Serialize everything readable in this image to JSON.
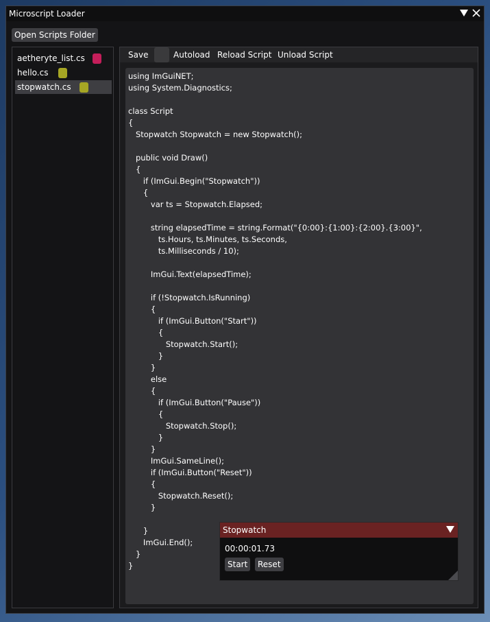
{
  "window": {
    "title": "Microscript Loader"
  },
  "toolbar": {
    "open_folder_label": "Open Scripts Folder"
  },
  "scripts": [
    {
      "name": "aetheryte_list.cs",
      "status_color": "#c41e5a",
      "selected": false
    },
    {
      "name": "hello.cs",
      "status_color": "#a6a624",
      "selected": false
    },
    {
      "name": "stopwatch.cs",
      "status_color": "#a6a624",
      "selected": true
    }
  ],
  "editor": {
    "menu": {
      "save": "Save",
      "autoload": "Autoload",
      "reload": "Reload Script",
      "unload": "Unload Script"
    },
    "code": "using ImGuiNET;\nusing System.Diagnostics;\n\nclass Script\n{\n   Stopwatch Stopwatch = new Stopwatch();\n\n   public void Draw()\n   {\n      if (ImGui.Begin(\"Stopwatch\"))\n      {\n         var ts = Stopwatch.Elapsed;\n\n         string elapsedTime = string.Format(\"{0:00}:{1:00}:{2:00}.{3:00}\",\n            ts.Hours, ts.Minutes, ts.Seconds,\n            ts.Milliseconds / 10);\n\n         ImGui.Text(elapsedTime);\n\n         if (!Stopwatch.IsRunning)\n         {\n            if (ImGui.Button(\"Start\"))\n            {\n               Stopwatch.Start();\n            }\n         }\n         else\n         {\n            if (ImGui.Button(\"Pause\"))\n            {\n               Stopwatch.Stop();\n            }\n         }\n         ImGui.SameLine();\n         if (ImGui.Button(\"Reset\"))\n         {\n            Stopwatch.Reset();\n         }\n\n      }\n      ImGui.End();\n   }\n}"
  },
  "stopwatch_window": {
    "title": "Stopwatch",
    "time": "00:00:01.73",
    "start_label": "Start",
    "reset_label": "Reset"
  },
  "colors": {
    "accent_titlebar": "#6a2222",
    "panel_bg": "#141416",
    "button_bg": "#3e3e42"
  }
}
